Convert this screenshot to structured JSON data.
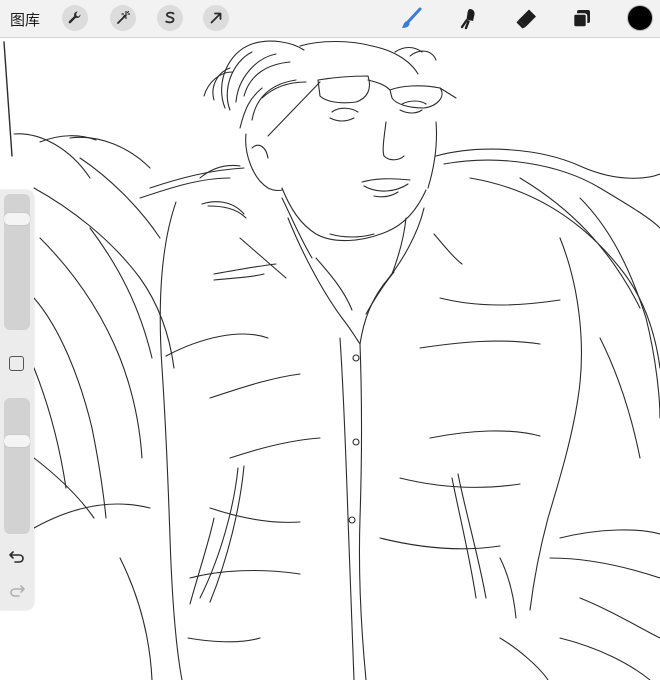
{
  "topbar": {
    "gallery_label": "图库",
    "left_tools": [
      {
        "name": "wrench-icon"
      },
      {
        "name": "magic-wand-icon"
      },
      {
        "name": "selection-s-icon"
      },
      {
        "name": "transform-arrow-icon"
      }
    ],
    "right_tools": [
      {
        "name": "brush-icon",
        "color": "#3a7bd5"
      },
      {
        "name": "smudge-icon"
      },
      {
        "name": "eraser-icon"
      },
      {
        "name": "layers-icon"
      }
    ],
    "current_color": "#000000"
  },
  "sidebar": {
    "brush_size_level": 0.85,
    "opacity_level": 0.7,
    "modify_button": "square-icon",
    "undo": "undo-icon",
    "redo": "redo-icon"
  },
  "canvas": {
    "content": "line-sketch"
  }
}
